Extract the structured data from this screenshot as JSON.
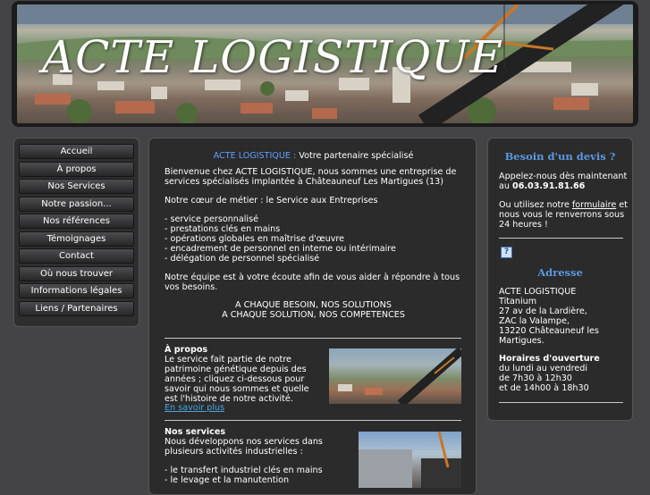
{
  "banner": {
    "title": "ACTE LOGISTIQUE"
  },
  "nav": {
    "items": [
      {
        "label": "Accueil"
      },
      {
        "label": "À propos"
      },
      {
        "label": "Nos Services"
      },
      {
        "label": "Notre passion..."
      },
      {
        "label": "Nos références"
      },
      {
        "label": "Témoignages"
      },
      {
        "label": "Contact"
      },
      {
        "label": "Où nous trouver"
      },
      {
        "label": "Informations légales"
      },
      {
        "label": "Liens / Partenaires"
      }
    ]
  },
  "main": {
    "intro_brand": "ACTE LOGISTIQUE :",
    "intro_tagline": "Votre partenaire spécialisé",
    "welcome_1": "Bienvenue chez ACTE LOGISTIQUE, nous sommes une entreprise de",
    "welcome_2": "services spécialisés implantée à Châteauneuf Les Martigues (13)",
    "core": "Notre cœur de métier : le Service aux Entreprises",
    "list": [
      "- service personnalisé",
      "- prestations clés en mains",
      "- opérations globales en maîtrise d'œuvre",
      "- encadrement de personnel en interne ou intérimaire",
      "- délégation de personnel spécialisé"
    ],
    "team_1": "Notre équipe est à votre écoute afin de vous aider à répondre à tous",
    "team_2": "vos besoins.",
    "slogan_1": "A CHAQUE BESOIN, NOS SOLUTIONS",
    "slogan_2": "A CHAQUE SOLUTION, NOS COMPETENCES",
    "about_title": "À propos",
    "about_lines": [
      "Le service fait partie de notre",
      "patrimoine génétique depuis des",
      "années ; cliquez ci-dessous pour",
      "savoir qui nous sommes et quelle",
      "est l'histoire de notre activité."
    ],
    "about_link": "En savoir plus",
    "services_title": "Nos services",
    "services_lines": [
      "Nous développons nos services dans",
      "plusieurs activités industrielles :"
    ],
    "services_list": [
      "- le transfert industriel clés en mains",
      "- le levage et la manutention"
    ]
  },
  "sidebar": {
    "quote_title": "Besoin d'un devis ?",
    "call_1": "Appelez-nous dès maintenant",
    "call_2_prefix": "au",
    "phone": "06.03.91.81.66",
    "form_prefix": "Ou utilisez notre",
    "form_link": "formulaire",
    "form_suffix": "et",
    "reply_1": "nous vous le renverrons sous",
    "reply_2": "24 heures !",
    "help_icon_glyph": "?",
    "address_title": "Adresse",
    "address_lines": [
      "ACTE LOGISTIQUE",
      "Titanium",
      "27 av de la Lardière,",
      "ZAC la Valampe,",
      "13220 Châteauneuf les",
      "Martigues."
    ],
    "hours_title": "Horaires d'ouverture",
    "hours_lines": [
      "du lundi au vendredi",
      "de 7h30 à 12h30",
      "et de 14h00 à 18h30"
    ]
  },
  "icons": {
    "help": "help-icon"
  },
  "colors": {
    "accent_heading": "#5b98e0",
    "brand_blue": "#5fa0ff",
    "link": "#4aa6e0"
  }
}
